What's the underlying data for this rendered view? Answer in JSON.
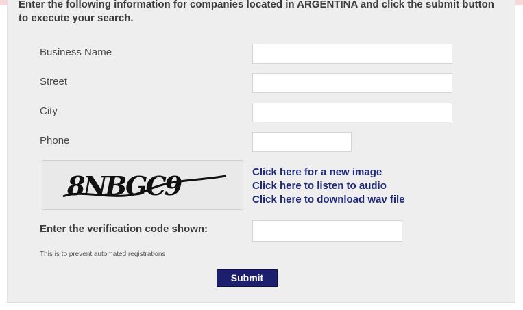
{
  "intro_text": "Enter the following information for companies located in ARGENTINA and click the submit button to execute your search.",
  "fields": {
    "business_name": {
      "label": "Business Name",
      "value": ""
    },
    "street": {
      "label": "Street",
      "value": ""
    },
    "city": {
      "label": "City",
      "value": ""
    },
    "phone": {
      "label": "Phone",
      "value": ""
    }
  },
  "captcha": {
    "image_text": "8NBGC9",
    "links": {
      "new_image": "Click here for a new image",
      "listen_audio": "Click here to listen to audio",
      "download_wav": "Click here to download wav file"
    }
  },
  "verification": {
    "label": "Enter the verification code shown:",
    "value": "",
    "note": "This is to prevent automated registrations"
  },
  "submit": {
    "label": "Submit"
  },
  "colors": {
    "panel_bg": "#eeeeee",
    "link": "#1f2a78",
    "button_bg": "#1c1f6e",
    "top_strip": "#f6d8da"
  }
}
